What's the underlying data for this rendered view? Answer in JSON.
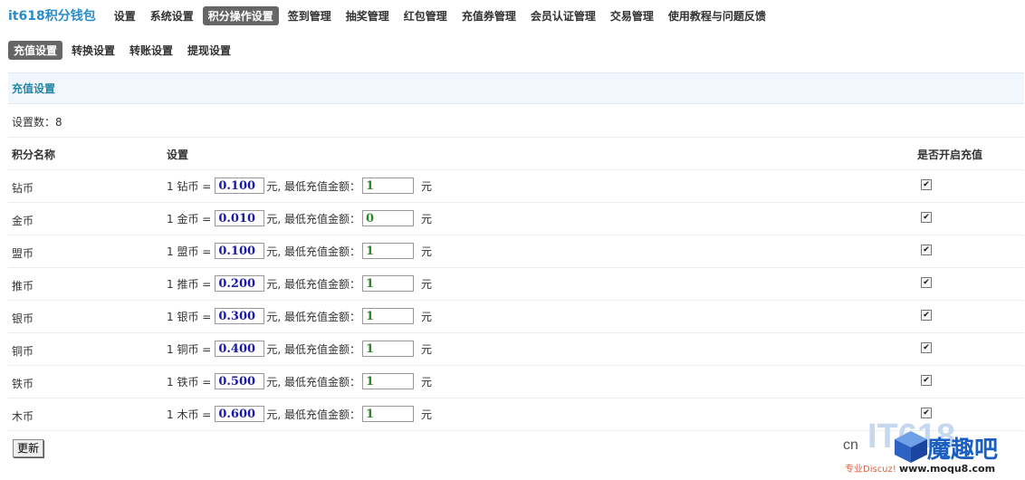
{
  "app": {
    "title": "it618积分钱包"
  },
  "top_nav": {
    "items": [
      {
        "label": "设置",
        "active": false
      },
      {
        "label": "系统设置",
        "active": false
      },
      {
        "label": "积分操作设置",
        "active": true
      },
      {
        "label": "签到管理",
        "active": false
      },
      {
        "label": "抽奖管理",
        "active": false
      },
      {
        "label": "红包管理",
        "active": false
      },
      {
        "label": "充值券管理",
        "active": false
      },
      {
        "label": "会员认证管理",
        "active": false
      },
      {
        "label": "交易管理",
        "active": false
      },
      {
        "label": "使用教程与问题反馈",
        "active": false
      }
    ]
  },
  "sub_nav": {
    "items": [
      {
        "label": "充值设置",
        "active": true
      },
      {
        "label": "转换设置",
        "active": false
      },
      {
        "label": "转账设置",
        "active": false
      },
      {
        "label": "提现设置",
        "active": false
      }
    ]
  },
  "section": {
    "title": "充值设置",
    "count_label": "设置数：8"
  },
  "table": {
    "headers": {
      "name": "积分名称",
      "setting": "设置",
      "enable": "是否开启充值"
    },
    "rows": [
      {
        "name": "钻币",
        "prefix": "1 钻币 =",
        "rate": "0.100",
        "mid": "元, 最低充值金额：",
        "min": "1",
        "unit": "元",
        "enabled": true
      },
      {
        "name": "金币",
        "prefix": "1 金币 =",
        "rate": "0.010",
        "mid": "元, 最低充值金额：",
        "min": "0",
        "unit": "元",
        "enabled": true
      },
      {
        "name": "盟币",
        "prefix": "1 盟币 =",
        "rate": "0.100",
        "mid": "元, 最低充值金额：",
        "min": "1",
        "unit": "元",
        "enabled": true
      },
      {
        "name": "推币",
        "prefix": "1 推币 =",
        "rate": "0.200",
        "mid": "元, 最低充值金额：",
        "min": "1",
        "unit": "元",
        "enabled": true
      },
      {
        "name": "银币",
        "prefix": "1 银币 =",
        "rate": "0.300",
        "mid": "元, 最低充值金额：",
        "min": "1",
        "unit": "元",
        "enabled": true
      },
      {
        "name": "铜币",
        "prefix": "1 铜币 =",
        "rate": "0.400",
        "mid": "元, 最低充值金额：",
        "min": "1",
        "unit": "元",
        "enabled": true
      },
      {
        "name": "铁币",
        "prefix": "1 铁币 =",
        "rate": "0.500",
        "mid": "元, 最低充值金额：",
        "min": "1",
        "unit": "元",
        "enabled": true
      },
      {
        "name": "木币",
        "prefix": "1 木币 =",
        "rate": "0.600",
        "mid": "元, 最低充值金额：",
        "min": "1",
        "unit": "元",
        "enabled": true
      }
    ]
  },
  "actions": {
    "update_label": "更新"
  },
  "watermark": {
    "cn": "cn",
    "it": "IT618",
    "brand": "魔趣吧",
    "sub": "专业Discuz!",
    "url": "www.moqu8.com"
  }
}
